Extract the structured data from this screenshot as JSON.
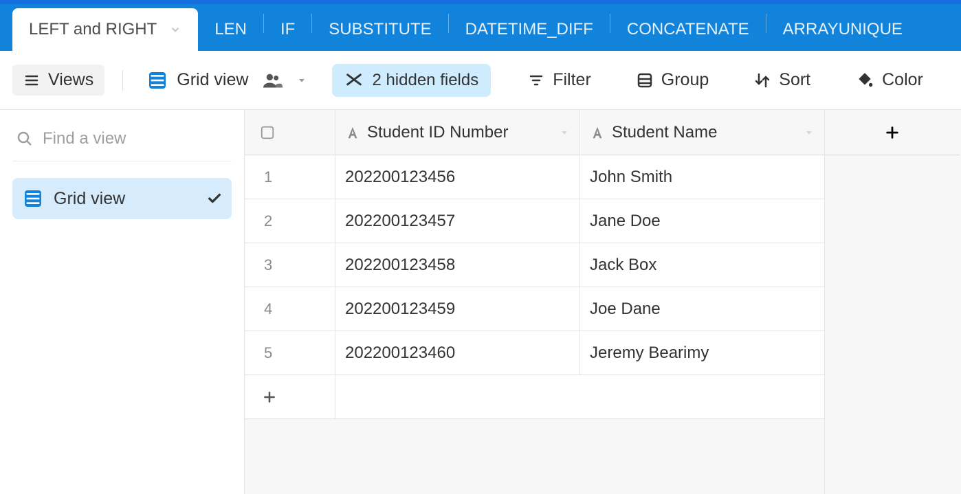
{
  "tabs": [
    {
      "label": "LEFT and RIGHT",
      "active": true
    },
    {
      "label": "LEN"
    },
    {
      "label": "IF"
    },
    {
      "label": "SUBSTITUTE"
    },
    {
      "label": "DATETIME_DIFF"
    },
    {
      "label": "CONCATENATE"
    },
    {
      "label": "ARRAYUNIQUE"
    }
  ],
  "toolbar": {
    "views_label": "Views",
    "view_name": "Grid view",
    "hidden_fields": "2 hidden fields",
    "filter": "Filter",
    "group": "Group",
    "sort": "Sort",
    "color": "Color"
  },
  "sidebar": {
    "search_placeholder": "Find a view",
    "views": [
      {
        "label": "Grid view",
        "active": true
      }
    ]
  },
  "grid": {
    "columns": [
      {
        "label": "Student ID Number"
      },
      {
        "label": "Student Name"
      }
    ],
    "rows": [
      {
        "n": "1",
        "id": "202200123456",
        "name": "John Smith"
      },
      {
        "n": "2",
        "id": "202200123457",
        "name": "Jane Doe"
      },
      {
        "n": "3",
        "id": "202200123458",
        "name": "Jack Box"
      },
      {
        "n": "4",
        "id": "202200123459",
        "name": "Joe Dane"
      },
      {
        "n": "5",
        "id": "202200123460",
        "name": "Jeremy Bearimy"
      }
    ]
  }
}
